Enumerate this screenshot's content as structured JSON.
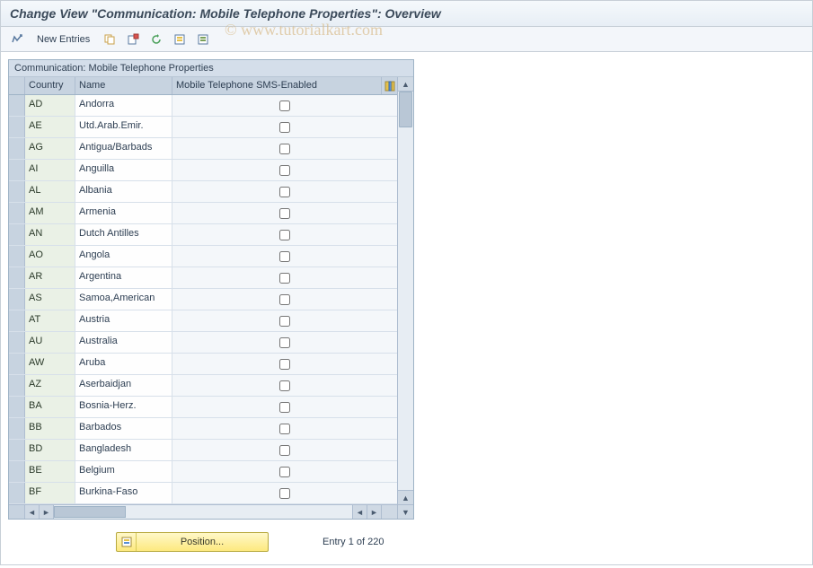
{
  "header": {
    "title": "Change View \"Communication: Mobile Telephone Properties\": Overview"
  },
  "toolbar": {
    "new_entries_label": "New Entries"
  },
  "panel": {
    "title": "Communication: Mobile Telephone Properties",
    "columns": {
      "country": "Country",
      "name": "Name",
      "sms": "Mobile Telephone SMS-Enabled"
    },
    "rows": [
      {
        "country": "AD",
        "name": "Andorra",
        "sms": false
      },
      {
        "country": "AE",
        "name": "Utd.Arab.Emir.",
        "sms": false
      },
      {
        "country": "AG",
        "name": "Antigua/Barbads",
        "sms": false
      },
      {
        "country": "AI",
        "name": "Anguilla",
        "sms": false
      },
      {
        "country": "AL",
        "name": "Albania",
        "sms": false
      },
      {
        "country": "AM",
        "name": "Armenia",
        "sms": false
      },
      {
        "country": "AN",
        "name": "Dutch Antilles",
        "sms": false
      },
      {
        "country": "AO",
        "name": "Angola",
        "sms": false
      },
      {
        "country": "AR",
        "name": "Argentina",
        "sms": false
      },
      {
        "country": "AS",
        "name": "Samoa,American",
        "sms": false
      },
      {
        "country": "AT",
        "name": "Austria",
        "sms": false
      },
      {
        "country": "AU",
        "name": "Australia",
        "sms": false
      },
      {
        "country": "AW",
        "name": "Aruba",
        "sms": false
      },
      {
        "country": "AZ",
        "name": "Aserbaidjan",
        "sms": false
      },
      {
        "country": "BA",
        "name": "Bosnia-Herz.",
        "sms": false
      },
      {
        "country": "BB",
        "name": "Barbados",
        "sms": false
      },
      {
        "country": "BD",
        "name": "Bangladesh",
        "sms": false
      },
      {
        "country": "BE",
        "name": "Belgium",
        "sms": false
      },
      {
        "country": "BF",
        "name": "Burkina-Faso",
        "sms": false
      }
    ]
  },
  "footer": {
    "position_label": "Position...",
    "entry_text": "Entry 1 of 220"
  },
  "watermark": "© www.tutorialkart.com"
}
